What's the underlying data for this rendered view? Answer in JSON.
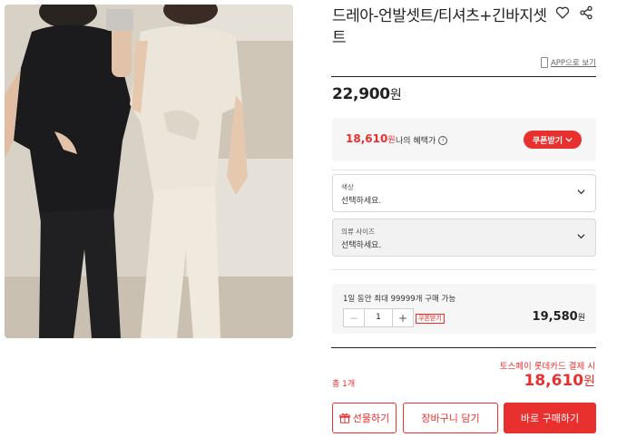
{
  "product": {
    "title": "드레아-언발셋트/티셔츠+긴바지셋트",
    "app_link": "APP으로 보기",
    "price": "22,900",
    "currency": "원"
  },
  "benefit": {
    "price": "18,610",
    "currency": "원",
    "label": "나의 혜택가",
    "info_icon": "i",
    "coupon_button": "쿠폰받기"
  },
  "options": [
    {
      "label": "색상",
      "value": "선택하세요."
    },
    {
      "label": "의류 사이즈",
      "value": "선택하세요."
    }
  ],
  "quantity": {
    "notice": "1일 동안 최대 99999개 구매 가능",
    "minus": "−",
    "value": "1",
    "plus": "+",
    "coupon_tag": "쿠폰받기",
    "price": "19,580",
    "currency": "원"
  },
  "summary": {
    "promo": "토스페이 롯데카드 결제 시",
    "total_label": "총 1개",
    "total_price": "18,610",
    "currency": "원"
  },
  "actions": {
    "gift": "선물하기",
    "cart": "장바구니 담기",
    "buy": "바로 구매하기"
  },
  "colors": {
    "accent": "#e8302f",
    "text": "#222222",
    "panel": "#f6f6f6"
  },
  "icons": [
    "heart-icon",
    "share-icon",
    "phone-icon",
    "info-icon",
    "chevron-down-icon",
    "gift-icon"
  ]
}
